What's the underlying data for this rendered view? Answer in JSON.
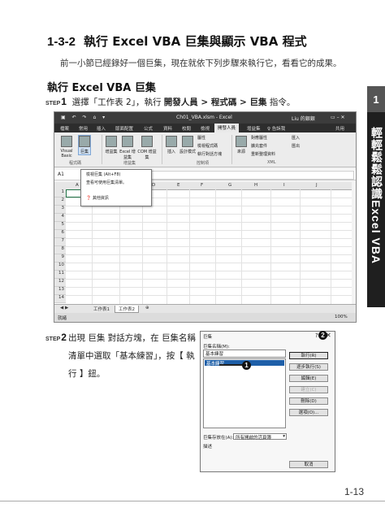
{
  "section": {
    "code": "1-3-2",
    "title": "執行 Excel VBA 巨集與顯示 VBA 程式"
  },
  "intro": "前一小節已經錄好一個巨集，現在就依下列步驟來執行它，看看它的成果。",
  "subsection": "執行 Excel VBA 巨集",
  "step_label": "STEP",
  "step1": {
    "num": "1",
    "pre": "選擇「工作表 2」，執行 ",
    "bold": "開發人員 > 程式碼 > 巨集",
    "post": " 指令。"
  },
  "step2": {
    "num": "2",
    "text": "出現 巨集 對話方塊，在 巨集名稱 清單中選取「基本練習」，按【 執行 】鈕。"
  },
  "side_tab": {
    "number": "1",
    "text_cjk": "輕輕鬆鬆認識",
    "text_latin": "Excel VBA"
  },
  "excel": {
    "title": "Ch01_VBA.xlsm - Excel",
    "user": "Liu 的銀銀",
    "quick_access": "▣ ↶ ↷ ⌂ ▾",
    "tabs": [
      "檔案",
      "常用",
      "插入",
      "版面配置",
      "公式",
      "資料",
      "校閱",
      "檢視",
      "開發人員",
      "增益集",
      "♀ 告訴我",
      "共用"
    ],
    "active_tab": "開發人員",
    "ribbon": {
      "visual_basic": "Visual Basic",
      "macros": "巨集",
      "addins": "增益集",
      "excel_addins": "Excel 增益集",
      "com_addins": "COM 增益集",
      "insert": "插入",
      "design_mode": "設計模式",
      "properties": "屬性",
      "view_code": "檢視程式碼",
      "run_dialog": "執行對話方塊",
      "source": "來源",
      "map_props": "對應屬性",
      "expansion": "擴充套件",
      "refresh": "重新整理資料",
      "import": "匯入",
      "export": "匯出",
      "group_code": "程式碼",
      "group_addins": "增益集",
      "group_controls": "控制項",
      "group_xml": "XML"
    },
    "menu": [
      "檢視巨集 (Alt+F8)",
      "查看可使用巨集清單。",
      "其他資訊"
    ],
    "name_box": "A1",
    "columns": [
      "A",
      "B",
      "C",
      "D",
      "E",
      "F",
      "G",
      "H",
      "I",
      "J"
    ],
    "rows": [
      "1",
      "2",
      "3",
      "4",
      "5",
      "6",
      "7",
      "8",
      "9",
      "10",
      "11",
      "12",
      "13",
      "14"
    ],
    "sheets": [
      "工作表1",
      "工作表2"
    ],
    "active_sheet": "工作表2",
    "status_ready": "就緒",
    "zoom": "100%"
  },
  "dialog": {
    "title": "巨集",
    "name_label": "巨集名稱(M):",
    "name_value": "基本練習",
    "list_items": [
      "基本練習"
    ],
    "buttons": [
      "執行(R)",
      "逐步執行(S)",
      "編輯(E)",
      "建立(C)",
      "刪除(D)",
      "選項(O)..."
    ],
    "disabled_buttons": [
      "建立(C)"
    ],
    "macros_in_label": "巨集存放在(A):",
    "macros_in_value": "所有開啟的活頁簿",
    "description_label": "描述",
    "cancel": "取消",
    "callouts": [
      "1",
      "2"
    ]
  },
  "page_number": "1-13"
}
